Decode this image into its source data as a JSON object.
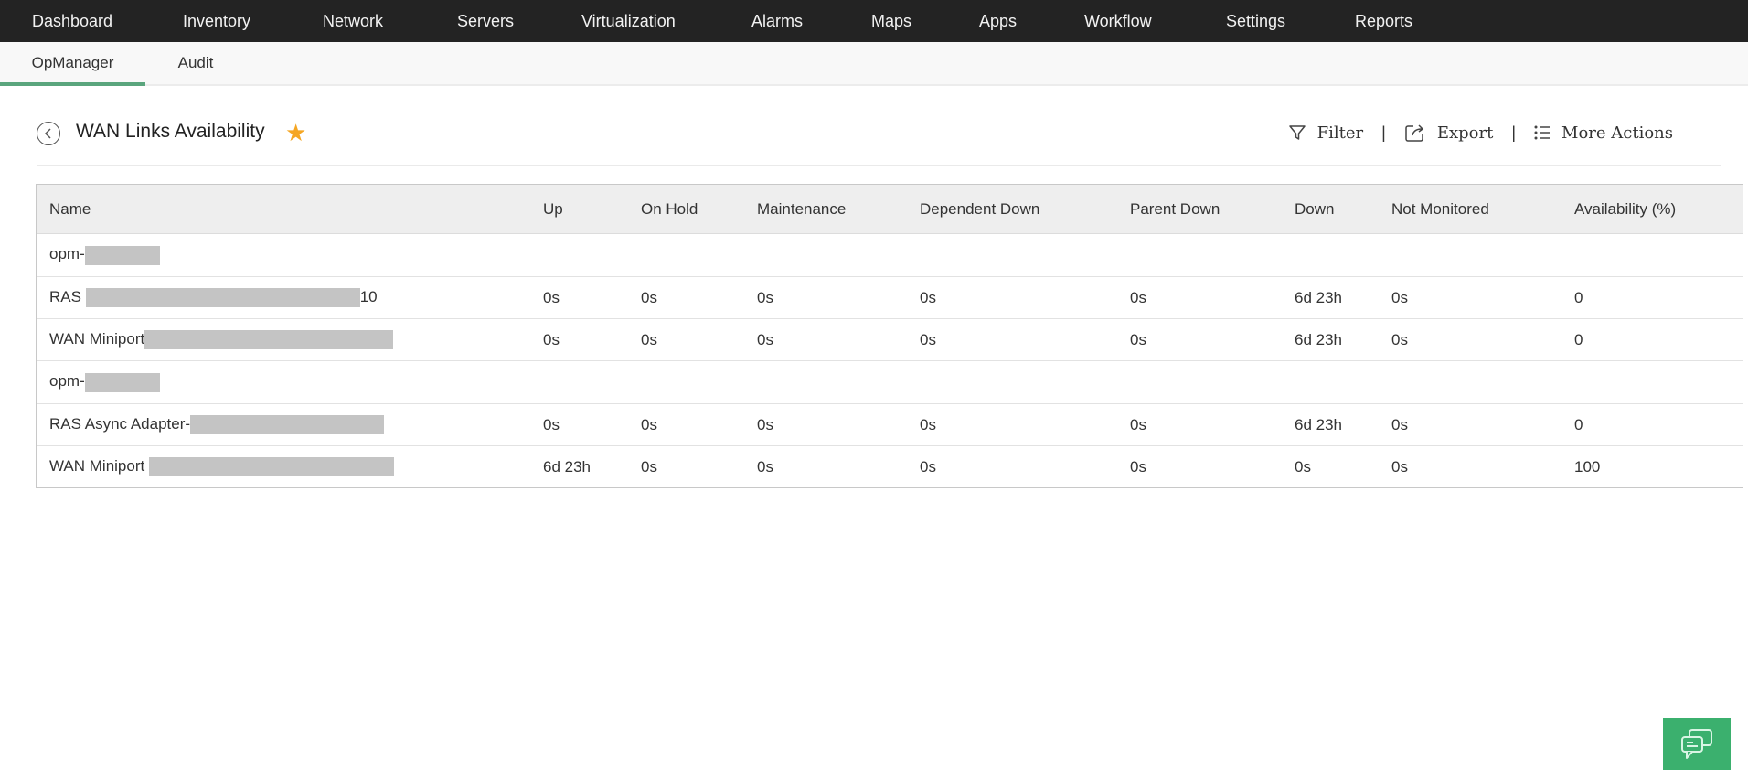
{
  "topnav": {
    "items": [
      "Dashboard",
      "Inventory",
      "Network",
      "Servers",
      "Virtualization",
      "Alarms",
      "Maps",
      "Apps",
      "Workflow",
      "Settings",
      "Reports"
    ]
  },
  "subnav": {
    "items": [
      {
        "label": "OpManager",
        "active": true
      },
      {
        "label": "Audit",
        "active": false
      }
    ],
    "accent_color": "#5aa57d"
  },
  "page": {
    "title": "WAN Links Availability",
    "favorite": true,
    "star_color": "#f5a623",
    "actions": {
      "filter": "Filter",
      "export": "Export",
      "more_actions": "More Actions",
      "separator": "|"
    }
  },
  "table": {
    "columns": [
      "Name",
      "Up",
      "On Hold",
      "Maintenance",
      "Dependent Down",
      "Parent Down",
      "Down",
      "Not Monitored",
      "Availability (%)"
    ],
    "rows": [
      {
        "type": "group",
        "name": "opm-",
        "redacted": true
      },
      {
        "type": "data",
        "name": "RAS ",
        "name_suffix": "10",
        "redacted": true,
        "cells": [
          "0s",
          "0s",
          "0s",
          "0s",
          "0s",
          "6d 23h",
          "0s",
          "0"
        ]
      },
      {
        "type": "data",
        "name": "WAN Miniport",
        "name_suffix": "",
        "redacted": true,
        "cells": [
          "0s",
          "0s",
          "0s",
          "0s",
          "0s",
          "6d 23h",
          "0s",
          "0"
        ]
      },
      {
        "type": "group",
        "name": "opm-",
        "redacted": true
      },
      {
        "type": "data",
        "name": "RAS Async Adapter-",
        "name_suffix": "",
        "redacted": true,
        "cells": [
          "0s",
          "0s",
          "0s",
          "0s",
          "0s",
          "6d 23h",
          "0s",
          "0"
        ]
      },
      {
        "type": "data",
        "name": "WAN Miniport ",
        "name_suffix": "",
        "redacted": true,
        "cells": [
          "6d 23h",
          "0s",
          "0s",
          "0s",
          "0s",
          "0s",
          "0s",
          "100"
        ]
      }
    ]
  },
  "chat": {
    "icon": "chat-bubbles-icon",
    "color": "#3bb06e"
  }
}
